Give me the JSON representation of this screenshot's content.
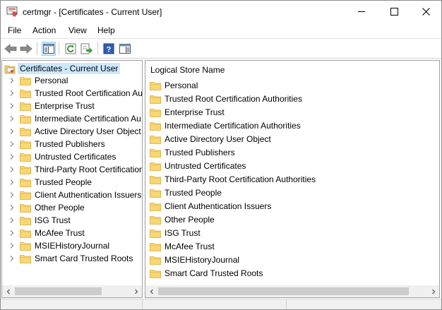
{
  "window": {
    "title": "certmgr - [Certificates - Current User]"
  },
  "title_buttons": {
    "minimize": "minimize-icon",
    "maximize": "maximize-icon",
    "close": "close-icon"
  },
  "menu": {
    "items": [
      "File",
      "Action",
      "View",
      "Help"
    ]
  },
  "toolbar": {
    "icons": [
      "back-arrow-icon",
      "forward-arrow-icon",
      "show-hide-console-tree-icon",
      "refresh-icon",
      "export-list-icon",
      "help-icon",
      "show-hide-action-pane-icon"
    ]
  },
  "tree": {
    "root": "Certificates - Current User",
    "items": [
      "Personal",
      "Trusted Root Certification Au",
      "Enterprise Trust",
      "Intermediate Certification Au",
      "Active Directory User Object",
      "Trusted Publishers",
      "Untrusted Certificates",
      "Third-Party Root Certification",
      "Trusted People",
      "Client Authentication Issuers",
      "Other People",
      "ISG Trust",
      "McAfee Trust",
      "MSIEHistoryJournal",
      "Smart Card Trusted Roots"
    ]
  },
  "list": {
    "header": "Logical Store Name",
    "items": [
      "Personal",
      "Trusted Root Certification Authorities",
      "Enterprise Trust",
      "Intermediate Certification Authorities",
      "Active Directory User Object",
      "Trusted Publishers",
      "Untrusted Certificates",
      "Third-Party Root Certification Authorities",
      "Trusted People",
      "Client Authentication Issuers",
      "Other People",
      "ISG Trust",
      "McAfee Trust",
      "MSIEHistoryJournal",
      "Smart Card Trusted Roots"
    ]
  },
  "colors": {
    "selection": "#cce8ff",
    "folder": "#f8d775",
    "folder_dark": "#e3b44a",
    "scroll_track": "#f0f0f0",
    "scroll_thumb": "#cdcdcd"
  }
}
